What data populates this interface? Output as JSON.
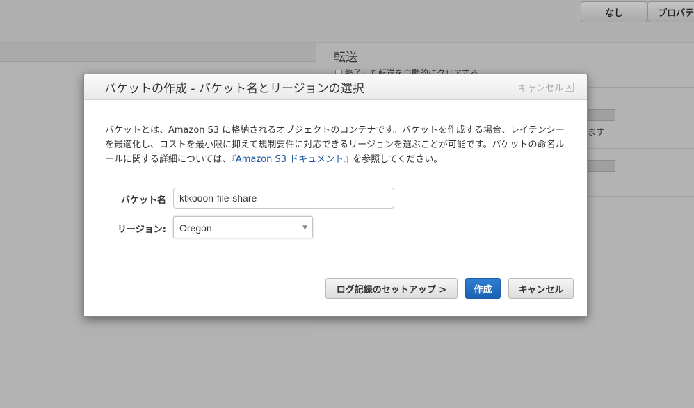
{
  "background": {
    "tabs": {
      "none": "なし",
      "properties": "プロパティ"
    },
    "transfer": {
      "title": "転送",
      "auto_clear": "終了した転送を自動的にクリアする"
    },
    "truncated_text": "ます"
  },
  "modal": {
    "title": "バケットの作成 - バケット名とリージョンの選択",
    "header_cancel": "キャンセル",
    "close_glyph": "x",
    "description": {
      "text_before_link": "バケットとは、Amazon S3 に格納されるオブジェクトのコンテナです。バケットを作成する場合、レイテンシーを最適化し、コストを最小限に抑えて規制要件に対応できるリージョンを選ぶことが可能です。バケットの命名ルールに関する詳細については、『",
      "link": "Amazon S3 ドキュメント",
      "text_after_link": "』を参照してください。"
    },
    "form": {
      "bucket_label": "バケット名",
      "bucket_value": "ktkooon-file-share",
      "region_label": "リージョン:",
      "region_value": "Oregon"
    },
    "buttons": {
      "logging": "ログ記録のセットアップ >",
      "create": "作成",
      "cancel": "キャンセル"
    },
    "colors": {
      "primary": "#1b62b3",
      "link": "#1a55a3"
    }
  }
}
